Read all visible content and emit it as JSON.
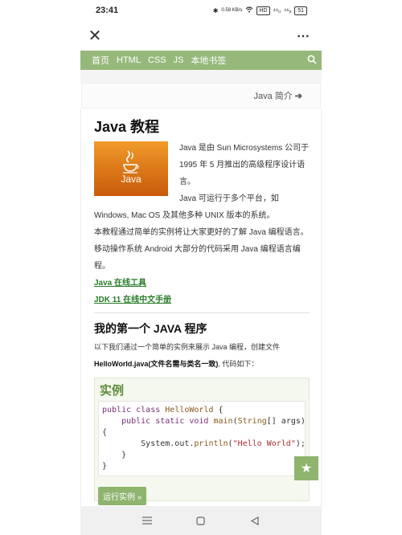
{
  "status": {
    "time": "23:41",
    "net_speed": "0.58 KB/s",
    "hd": "HD",
    "sig1": "⁴⁶ᵢₗ",
    "sig2": "⁴⁶ᵢₗ",
    "battery": "51"
  },
  "titlebar": {
    "close_glyph": "✕",
    "more_glyph": "⋯"
  },
  "nav": {
    "items": [
      "首页",
      "HTML",
      "CSS",
      "JS",
      "本地书签"
    ]
  },
  "prev": {
    "label": "Java 简介",
    "arrow": "➔"
  },
  "article": {
    "title": "Java 教程",
    "logo_word": "Java",
    "p1": "Java 是由 Sun Microsystems 公司于 1995 年 5 月推出的高级程序设计语言。",
    "p2": "Java 可运行于多个平台，如 Windows, Mac OS 及其他多种 UNIX 版本的系统。",
    "p3": "本教程通过简单的实例将让大家更好的了解 Java 编程语言。",
    "p4": "移动操作系统 Android 大部分的代码采用 Java 编程语言编程。",
    "link1": "Java 在线工具",
    "link2": "JDK 11 在线中文手册",
    "h2": "我的第一个 JAVA 程序",
    "desc_a": "以下我们通过一个简单的实例来展示 Java 编程，创建文件 ",
    "desc_file": "HelloWorld.java(文件名需与类名一致)",
    "desc_b": ", 代码如下：",
    "example_title": "实例",
    "code": {
      "l1_kw": "public class ",
      "l1_name": "HelloWorld",
      "l1_end": " {",
      "l2_kw": "    public static void ",
      "l2_fn": "main",
      "l2_args": "(",
      "l2_type": "String",
      "l2_rest": "[] args)",
      "l3": "{",
      "l4_pre": "        System.out.",
      "l4_fn": "println",
      "l4_open": "(",
      "l4_str": "\"Hello World\"",
      "l4_close": ");",
      "l5": "    }",
      "l6": "}"
    },
    "run_label": "运行实例 »"
  },
  "fav_glyph": "★",
  "colors": {
    "accent": "#96b97b",
    "link": "#2a7d2a",
    "example_title": "#5f8a3a"
  }
}
